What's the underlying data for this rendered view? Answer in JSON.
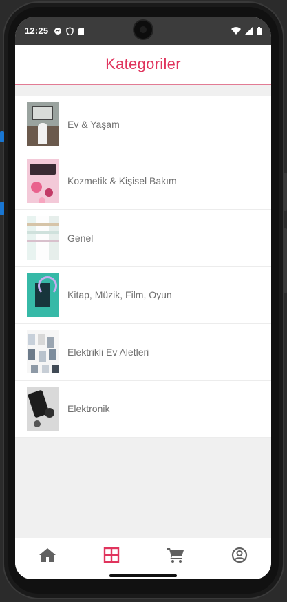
{
  "status_bar": {
    "time": "12:25",
    "left_icons": [
      "messenger-icon",
      "vpn-shield-icon",
      "sd-card-icon"
    ],
    "right_icons": [
      "wifi-icon",
      "signal-icon",
      "battery-icon"
    ]
  },
  "header": {
    "title": "Kategoriler"
  },
  "categories": [
    {
      "label": "Ev & Yaşam",
      "image": "home-living-thumbnail"
    },
    {
      "label": "Kozmetik & Kişisel Bakım",
      "image": "cosmetics-thumbnail"
    },
    {
      "label": "Genel",
      "image": "general-store-thumbnail"
    },
    {
      "label": "Kitap, Müzik, Film, Oyun",
      "image": "book-music-thumbnail"
    },
    {
      "label": "Elektrikli Ev Aletleri",
      "image": "home-appliances-thumbnail"
    },
    {
      "label": "Elektronik",
      "image": "electronics-thumbnail"
    }
  ],
  "bottom_nav": {
    "items": [
      {
        "icon": "home-icon",
        "active": false
      },
      {
        "icon": "categories-grid-icon",
        "active": true
      },
      {
        "icon": "cart-icon",
        "active": false
      },
      {
        "icon": "account-icon",
        "active": false
      }
    ],
    "active_color": "#e0345d",
    "inactive_color": "#616161"
  },
  "colors": {
    "accent": "#e0345d",
    "divider": "#e27b94"
  }
}
